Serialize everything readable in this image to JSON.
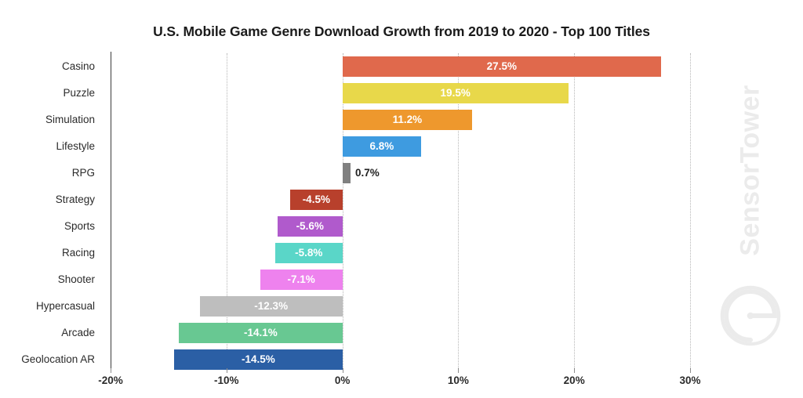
{
  "chart_data": {
    "type": "bar",
    "orientation": "horizontal",
    "title": "U.S. Mobile Game Genre Download Growth from 2019 to 2020 - Top 100 Titles",
    "xlabel": "",
    "ylabel": "",
    "xlim": [
      -20,
      30
    ],
    "xticks": [
      -20,
      -10,
      0,
      10,
      20,
      30
    ],
    "xtick_labels": [
      "-20%",
      "-10%",
      "0%",
      "10%",
      "20%",
      "30%"
    ],
    "grid": "vertical-dotted",
    "legend": "none",
    "categories": [
      "Casino",
      "Puzzle",
      "Simulation",
      "Lifestyle",
      "RPG",
      "Strategy",
      "Sports",
      "Racing",
      "Shooter",
      "Hypercasual",
      "Arcade",
      "Geolocation AR"
    ],
    "values": [
      27.5,
      19.5,
      11.2,
      6.8,
      0.7,
      -4.5,
      -5.6,
      -5.8,
      -7.1,
      -12.3,
      -14.1,
      -14.5
    ],
    "value_labels": [
      "27.5%",
      "19.5%",
      "11.2%",
      "6.8%",
      "0.7%",
      "-4.5%",
      "-5.6%",
      "-5.8%",
      "-7.1%",
      "-12.3%",
      "-14.1%",
      "-14.5%"
    ],
    "colors": [
      "#E0694C",
      "#E8D84A",
      "#EE982D",
      "#3E9BE0",
      "#808080",
      "#B8402C",
      "#B05ACC",
      "#5AD6C8",
      "#EE82EE",
      "#BEBEBE",
      "#68C892",
      "#2B5FA5"
    ],
    "label_placement": [
      "inside",
      "inside",
      "inside",
      "inside",
      "outside",
      "inside",
      "inside",
      "inside",
      "inside",
      "inside",
      "inside",
      "inside"
    ]
  },
  "watermark": {
    "text": "SensorTower",
    "color": "#ebebeb",
    "logo_icon": "sensortower-circle-logo"
  }
}
